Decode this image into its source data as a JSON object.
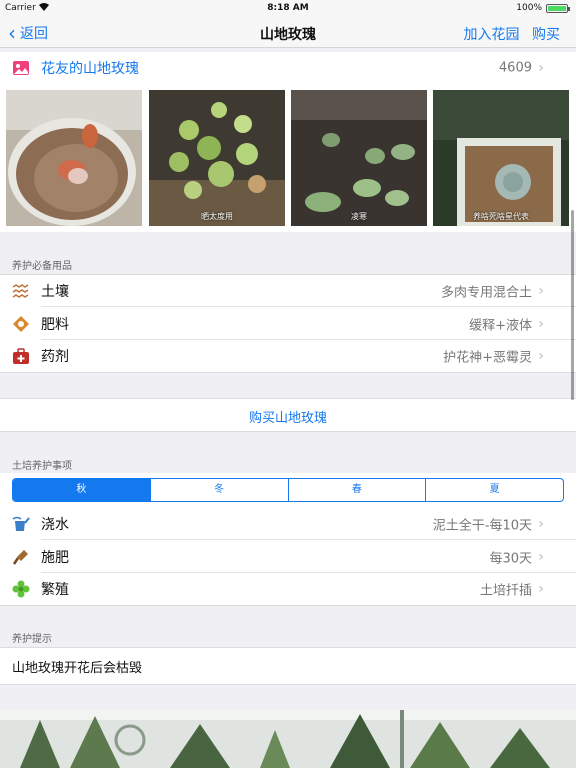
{
  "status_bar": {
    "carrier": "Carrier",
    "time": "8:18 AM",
    "battery_percent": "100%",
    "battery_level": 1.0
  },
  "nav": {
    "back_label": "返回",
    "title": "山地玫瑰",
    "add_garden_label": "加入花园",
    "buy_label": "购买"
  },
  "gallery": {
    "label": "花友的山地玫瑰",
    "count": "4609",
    "photos": [
      {
        "caption": ""
      },
      {
        "caption": "晒太度用"
      },
      {
        "caption": "凌寒"
      },
      {
        "caption": "养啥死啥星代表"
      }
    ]
  },
  "supplies": {
    "header": "养护必备用品",
    "items": [
      {
        "icon": "soil-icon",
        "label": "土壤",
        "value": "多肉专用混合土"
      },
      {
        "icon": "fertilizer-icon",
        "label": "肥料",
        "value": "缓释+液体"
      },
      {
        "icon": "medicine-icon",
        "label": "药剂",
        "value": "护花神+恶霉灵"
      }
    ]
  },
  "buy": {
    "label": "购买山地玫瑰"
  },
  "care": {
    "header": "土培养护事项",
    "seasons": [
      "秋",
      "冬",
      "春",
      "夏"
    ],
    "selected_season": "秋",
    "items": [
      {
        "icon": "watering-can-icon",
        "label": "浇水",
        "value": "泥土全干-每10天"
      },
      {
        "icon": "shovel-icon",
        "label": "施肥",
        "value": "每30天"
      },
      {
        "icon": "propagation-icon",
        "label": "繁殖",
        "value": "土培扦插"
      }
    ]
  },
  "tips": {
    "header": "养护提示",
    "text": "山地玫瑰开花后会枯毁"
  },
  "colors": {
    "accent": "#1479ee",
    "background": "#efeff4"
  }
}
